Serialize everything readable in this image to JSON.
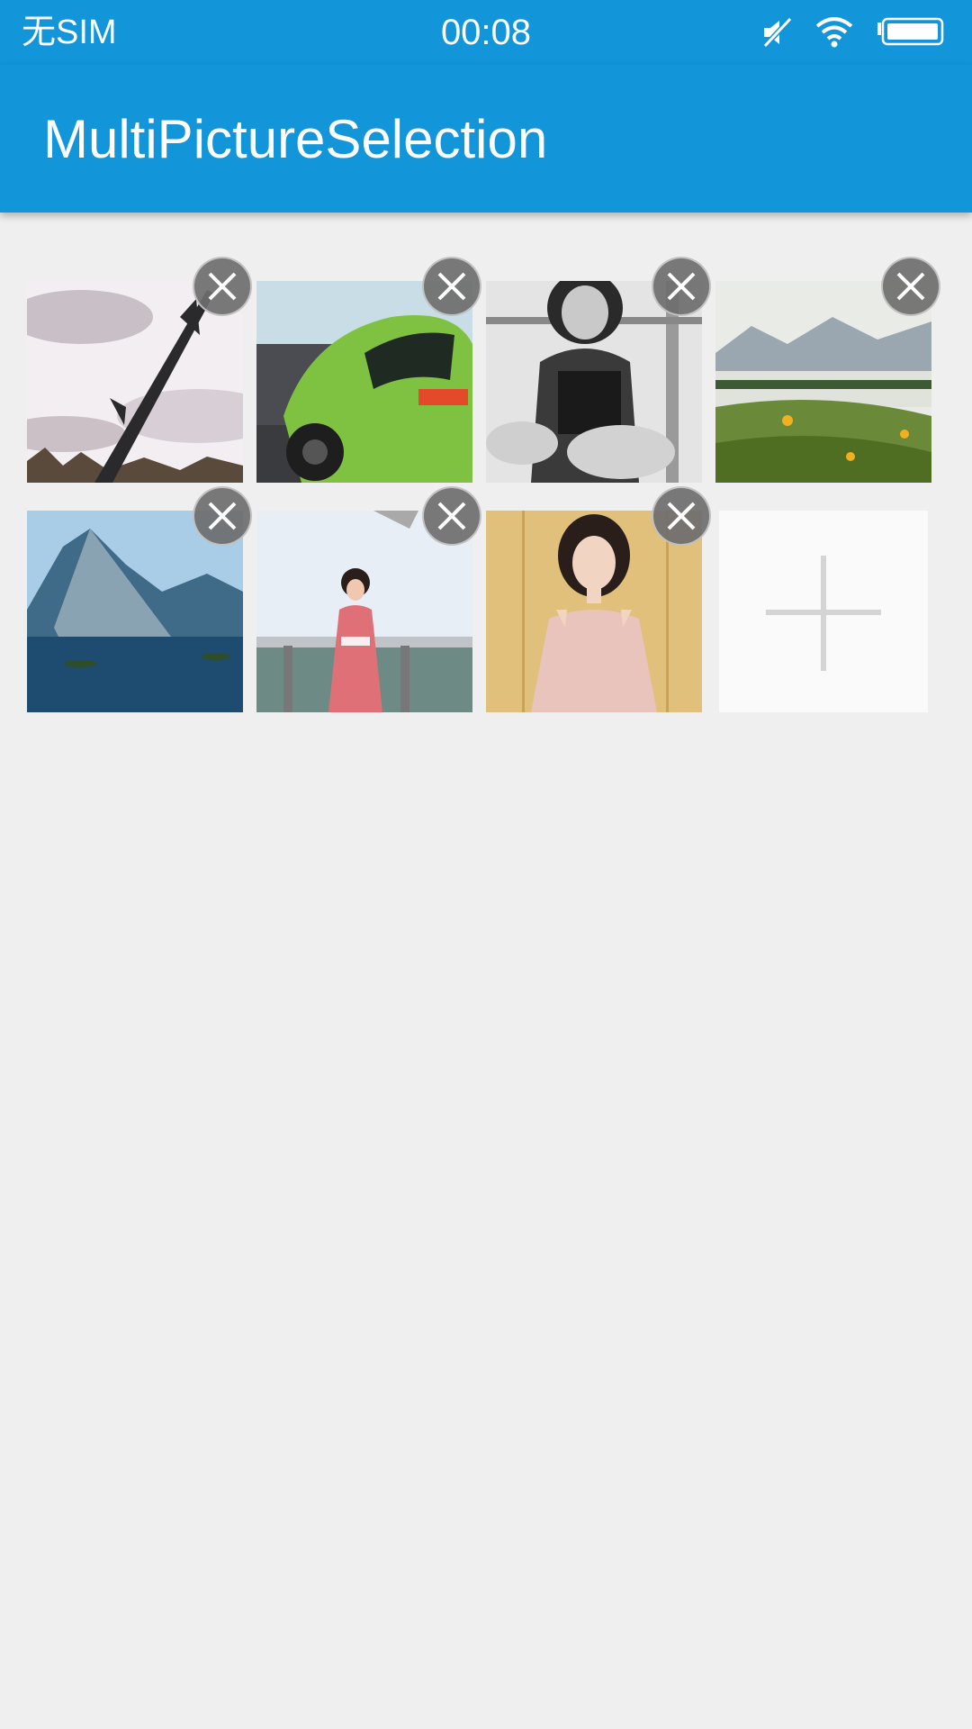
{
  "status_bar": {
    "carrier": "无SIM",
    "time": "00:08",
    "icons": [
      "mute-icon",
      "wifi-icon",
      "battery-icon"
    ],
    "battery_level": 1.0
  },
  "app_bar": {
    "title": "MultiPictureSelection",
    "color": "#1395d9"
  },
  "gallery": {
    "images": [
      {
        "name": "missile-photo",
        "description_icon": "image-thumbnail"
      },
      {
        "name": "green-race-car-photo",
        "description_icon": "image-thumbnail"
      },
      {
        "name": "bw-portrait-photo",
        "description_icon": "image-thumbnail"
      },
      {
        "name": "misty-meadow-photo",
        "description_icon": "image-thumbnail"
      },
      {
        "name": "mountain-lake-photo",
        "description_icon": "image-thumbnail"
      },
      {
        "name": "pink-dress-photo",
        "description_icon": "image-thumbnail"
      },
      {
        "name": "tulle-dress-photo",
        "description_icon": "image-thumbnail"
      }
    ],
    "remove_icon": "close-icon",
    "add_icon": "plus-icon"
  }
}
